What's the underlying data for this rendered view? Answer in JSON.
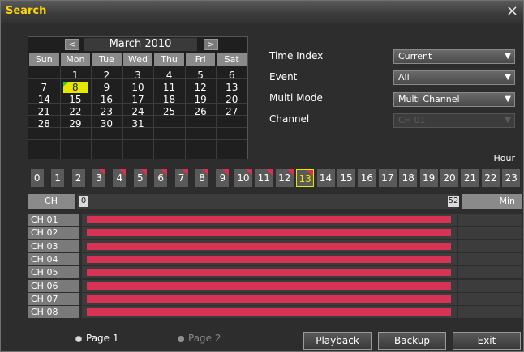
{
  "window": {
    "title": "Search",
    "close_glyph": "×"
  },
  "calendar": {
    "month_label": "March 2010",
    "prev_glyph": "<",
    "next_glyph": ">",
    "weekdays": [
      "Sun",
      "Mon",
      "Tue",
      "Wed",
      "Thu",
      "Fri",
      "Sat"
    ],
    "weeks": [
      [
        "",
        "1",
        "2",
        "3",
        "4",
        "5",
        "6"
      ],
      [
        "7",
        "8",
        "9",
        "10",
        "11",
        "12",
        "13"
      ],
      [
        "14",
        "15",
        "16",
        "17",
        "18",
        "19",
        "20"
      ],
      [
        "21",
        "22",
        "23",
        "24",
        "25",
        "26",
        "27"
      ],
      [
        "28",
        "29",
        "30",
        "31",
        "",
        "",
        ""
      ]
    ],
    "selected_day": "8"
  },
  "options": {
    "time_index": {
      "label": "Time Index",
      "value": "Current"
    },
    "event": {
      "label": "Event",
      "value": "All"
    },
    "multi_mode": {
      "label": "Multi Mode",
      "value": "Multi Channel"
    },
    "channel": {
      "label": "Channel",
      "value": "CH 01"
    }
  },
  "timeline": {
    "hour_label": "Hour",
    "hours": [
      "0",
      "1",
      "2",
      "3",
      "4",
      "5",
      "6",
      "7",
      "8",
      "9",
      "10",
      "11",
      "12",
      "13",
      "14",
      "15",
      "16",
      "17",
      "18",
      "19",
      "20",
      "21",
      "22",
      "23"
    ],
    "marked_hours": [
      "3",
      "4",
      "5",
      "6",
      "7",
      "8",
      "9",
      "10",
      "11",
      "12",
      "13"
    ],
    "selected_hour": "13",
    "ch_header": "CH",
    "start_minute": "0",
    "end_minute": "52",
    "min_header": "Min"
  },
  "channels": [
    {
      "label": "CH 01",
      "recorded_minutes": [
        0,
        52
      ]
    },
    {
      "label": "CH 02",
      "recorded_minutes": [
        0,
        52
      ]
    },
    {
      "label": "CH 03",
      "recorded_minutes": [
        0,
        52
      ]
    },
    {
      "label": "CH 04",
      "recorded_minutes": [
        0,
        52
      ]
    },
    {
      "label": "CH 05",
      "recorded_minutes": [
        0,
        52
      ]
    },
    {
      "label": "CH 06",
      "recorded_minutes": [
        0,
        52
      ]
    },
    {
      "label": "CH 07",
      "recorded_minutes": [
        0,
        52
      ]
    },
    {
      "label": "CH 08",
      "recorded_minutes": [
        0,
        52
      ]
    }
  ],
  "paging": {
    "page1": "Page 1",
    "page2": "Page 2",
    "selected": "Page 1"
  },
  "buttons": {
    "playback": "Playback",
    "backup": "Backup",
    "exit": "Exit"
  },
  "colors": {
    "title": "#ffd400",
    "recording": "#d63355",
    "selected_day": "#e6e600",
    "event_mark": "#32c832"
  }
}
